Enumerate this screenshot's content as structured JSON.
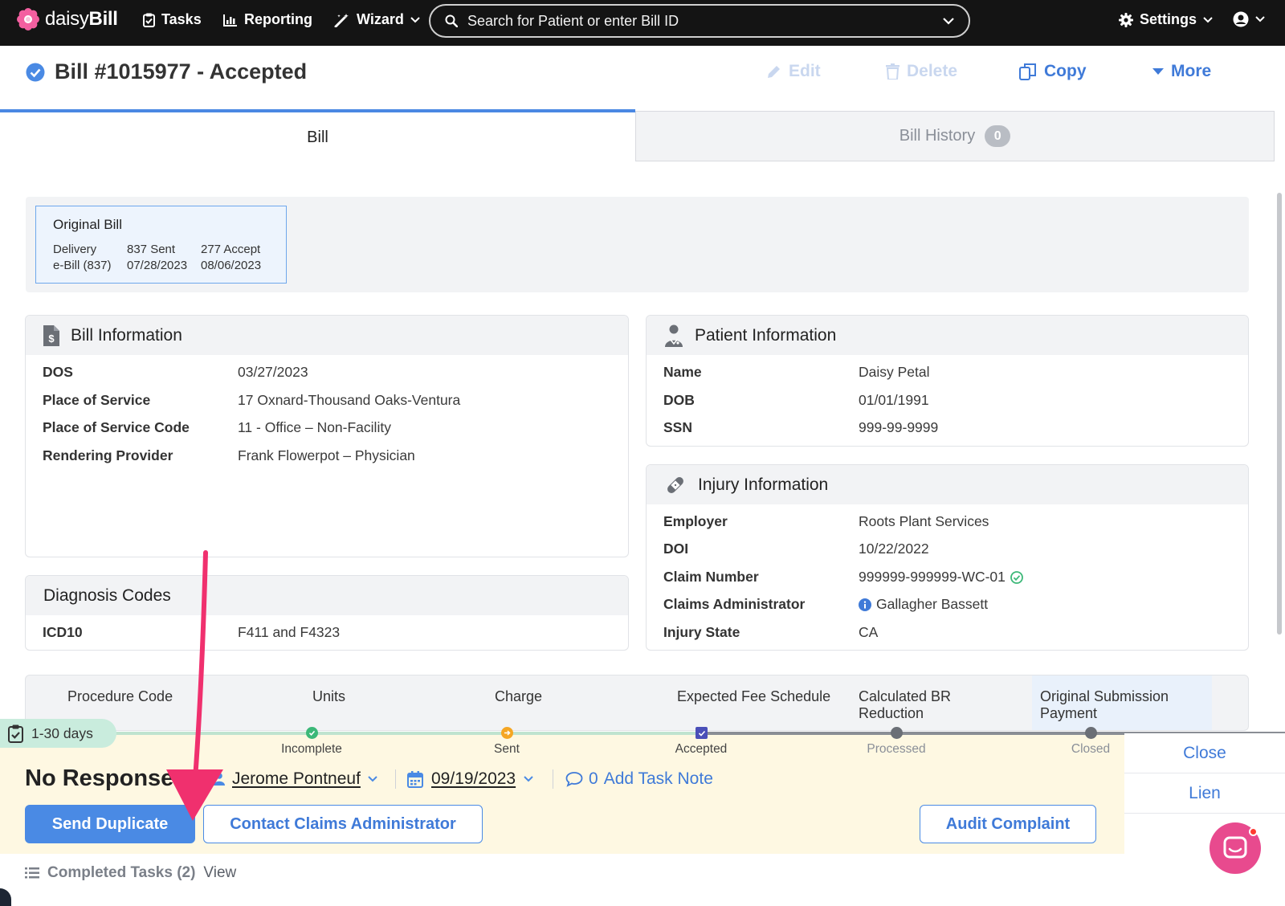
{
  "nav": {
    "logo_prefix": "daisy",
    "logo_suffix": "Bill",
    "tasks": "Tasks",
    "reporting": "Reporting",
    "wizard": "Wizard",
    "search_placeholder": "Search for Patient or enter Bill ID",
    "settings": "Settings"
  },
  "bill": {
    "title": "Bill #1015977 - Accepted",
    "actions": {
      "edit": "Edit",
      "delete": "Delete",
      "copy": "Copy",
      "more": "More"
    }
  },
  "tabs": {
    "bill": "Bill",
    "history": "Bill History",
    "history_count": "0"
  },
  "original_bill": {
    "title": "Original Bill",
    "headers": [
      "Delivery",
      "837 Sent",
      "277 Accept"
    ],
    "values": [
      "e-Bill (837)",
      "07/28/2023",
      "08/06/2023"
    ]
  },
  "bill_info": {
    "title": "Bill Information",
    "rows": [
      {
        "label": "DOS",
        "value": "03/27/2023"
      },
      {
        "label": "Place of Service",
        "value": "17 Oxnard-Thousand Oaks-Ventura"
      },
      {
        "label": "Place of Service Code",
        "value": "11 - Office – Non-Facility"
      },
      {
        "label": "Rendering Provider",
        "value": "Frank Flowerpot – Physician"
      }
    ]
  },
  "patient_info": {
    "title": "Patient Information",
    "rows": [
      {
        "label": "Name",
        "value": "Daisy Petal"
      },
      {
        "label": "DOB",
        "value": "01/01/1991"
      },
      {
        "label": "SSN",
        "value": "999-99-9999"
      }
    ]
  },
  "injury_info": {
    "title": "Injury Information",
    "rows": [
      {
        "label": "Employer",
        "value": "Roots Plant Services"
      },
      {
        "label": "DOI",
        "value": "10/22/2022"
      },
      {
        "label": "Claim Number",
        "value": "999999-999999-WC-01"
      },
      {
        "label": "Claims Administrator",
        "value": "Gallagher Bassett"
      },
      {
        "label": "Injury State",
        "value": "CA"
      }
    ]
  },
  "diagnosis": {
    "title": "Diagnosis Codes",
    "rows": [
      {
        "label": "ICD10",
        "value": "F411 and F4323"
      }
    ]
  },
  "procedure_table": {
    "columns": [
      "Procedure Code",
      "Units",
      "Charge",
      "Expected Fee Schedule",
      "Calculated BR Reduction",
      "Original Submission Payment"
    ]
  },
  "progress": {
    "steps": [
      {
        "label": "Incomplete",
        "state": "done",
        "color": "#3cb878"
      },
      {
        "label": "Sent",
        "state": "done",
        "color": "#f5a623"
      },
      {
        "label": "Accepted",
        "state": "current",
        "color": "#4a4fb8"
      },
      {
        "label": "Processed",
        "state": "pending",
        "color": "#6b6f76"
      },
      {
        "label": "Closed",
        "state": "pending",
        "color": "#6b6f76"
      }
    ]
  },
  "task": {
    "days": "1-30 days",
    "title": "No Response",
    "assignee": "Jerome Pontneuf",
    "due_date": "09/19/2023",
    "note_count": "0",
    "note_label": "Add Task Note",
    "send_duplicate": "Send Duplicate",
    "contact_admin": "Contact Claims Administrator",
    "audit_complaint": "Audit Complaint"
  },
  "side_actions": {
    "close": "Close",
    "lien": "Lien"
  },
  "completed_tasks": {
    "label": "Completed Tasks (2)",
    "view": "View"
  },
  "colors": {
    "accent": "#4a8ae4",
    "annotation_arrow": "#f0306e",
    "task_bg": "#fef8e2"
  }
}
